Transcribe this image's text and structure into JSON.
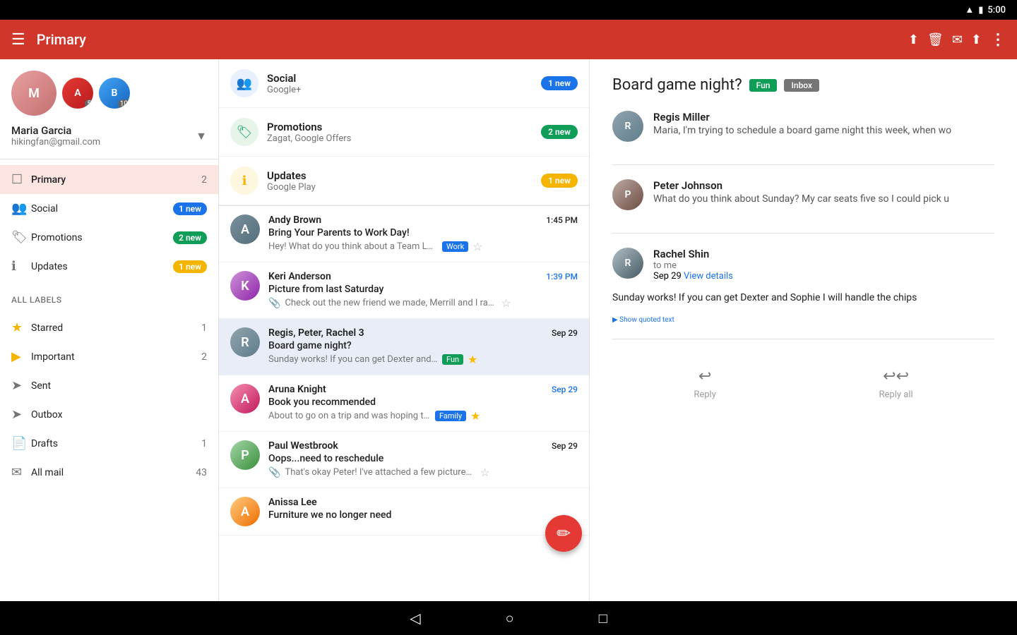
{
  "statusBar": {
    "time": "5:00"
  },
  "toolbar": {
    "title": "Primary",
    "menuIcon": "☰",
    "archiveIcon": "⬆",
    "deleteIcon": "🗑",
    "emailIcon": "✉",
    "labelIcon": "🏷",
    "moreIcon": "⋮"
  },
  "sidebar": {
    "user": {
      "name": "Maria Garcia",
      "email": "hikingfan@gmail.com",
      "avatarInitial": "M",
      "secondaryCount1": "5",
      "secondaryCount2": "10"
    },
    "navItems": [
      {
        "id": "primary",
        "label": "Primary",
        "icon": "☐",
        "count": "2",
        "active": true
      },
      {
        "id": "social",
        "label": "Social",
        "icon": "👥",
        "badge": "1 new",
        "badgeClass": "badge-blue"
      },
      {
        "id": "promotions",
        "label": "Promotions",
        "icon": "🏷",
        "badge": "2 new",
        "badgeClass": "badge-green"
      },
      {
        "id": "updates",
        "label": "Updates",
        "icon": "ℹ",
        "badge": "1 new",
        "badgeClass": "badge-yellow"
      }
    ],
    "allLabelsTitle": "All labels",
    "labelItems": [
      {
        "id": "starred",
        "label": "Starred",
        "icon": "★",
        "count": "1"
      },
      {
        "id": "important",
        "label": "Important",
        "icon": "▶",
        "count": "2"
      },
      {
        "id": "sent",
        "label": "Sent",
        "icon": "➤",
        "count": ""
      },
      {
        "id": "outbox",
        "label": "Outbox",
        "icon": "➤",
        "count": ""
      },
      {
        "id": "drafts",
        "label": "Drafts",
        "icon": "📄",
        "count": "1"
      },
      {
        "id": "allmail",
        "label": "All mail",
        "icon": "✉",
        "count": "43"
      }
    ]
  },
  "emailList": {
    "categories": [
      {
        "id": "social",
        "name": "Social",
        "sub": "Google+",
        "badge": "1 new",
        "badgeClass": "badge-blue",
        "iconClass": "cat-icon-blue",
        "icon": "👥"
      },
      {
        "id": "promotions",
        "name": "Promotions",
        "sub": "Zagat, Google Offers",
        "badge": "2 new",
        "badgeClass": "badge-green",
        "iconClass": "cat-icon-green",
        "icon": "🏷"
      },
      {
        "id": "updates",
        "name": "Updates",
        "sub": "Google Play",
        "badge": "1 new",
        "badgeClass": "badge-yellow",
        "iconClass": "cat-icon-yellow",
        "icon": "ℹ"
      }
    ],
    "emails": [
      {
        "id": "1",
        "sender": "Andy Brown",
        "subject": "Bring Your Parents to Work Day!",
        "preview": "Hey! What do you think about a Team Lunch: Parent...",
        "time": "1:45 PM",
        "timeBlue": false,
        "tag": "Work",
        "tagClass": "tag-work",
        "starred": false,
        "hasAttachment": false,
        "avatarClass": "av-andy",
        "initial": "A",
        "selected": false
      },
      {
        "id": "2",
        "sender": "Keri Anderson",
        "subject": "Picture from last Saturday",
        "preview": "Check out the new friend we made, Merrill and I ran into him...",
        "time": "1:39 PM",
        "timeBlue": true,
        "tag": "",
        "starred": false,
        "hasAttachment": true,
        "avatarClass": "av-keri",
        "initial": "K",
        "selected": false
      },
      {
        "id": "3",
        "sender": "Regis, Peter, Rachel  3",
        "subject": "Board game night?",
        "preview": "Sunday works! If you can get Dexter and Sophie I will...",
        "time": "Sep 29",
        "timeBlue": false,
        "tag": "Fun",
        "tagClass": "tag-fun",
        "starred": true,
        "hasAttachment": false,
        "avatarClass": "av-regis",
        "initial": "R",
        "selected": true
      },
      {
        "id": "4",
        "sender": "Aruna Knight",
        "subject": "Book you recommended",
        "preview": "About to go on a trip and was hoping to start that b...",
        "time": "Sep 29",
        "timeBlue": true,
        "tag": "Family",
        "tagClass": "tag-family",
        "starred": true,
        "hasAttachment": false,
        "avatarClass": "av-aruna",
        "initial": "A",
        "selected": false
      },
      {
        "id": "5",
        "sender": "Paul Westbrook",
        "subject": "Oops...need to reschedule",
        "preview": "That's okay Peter! I've attached a few pictures of my place f...",
        "time": "Sep 29",
        "timeBlue": false,
        "tag": "",
        "starred": false,
        "hasAttachment": true,
        "avatarClass": "av-paul",
        "initial": "P",
        "selected": false
      },
      {
        "id": "6",
        "sender": "Anissa Lee",
        "subject": "Furniture we no longer need",
        "preview": "",
        "time": "",
        "timeBlue": false,
        "tag": "",
        "starred": false,
        "hasAttachment": false,
        "avatarClass": "av-anissa",
        "initial": "A",
        "selected": false
      }
    ]
  },
  "emailDetail": {
    "subject": "Board game night?",
    "tagFun": "Fun",
    "tagInbox": "Inbox",
    "messages": [
      {
        "id": "m1",
        "sender": "Regis Miller",
        "preview": "Maria, I'm trying to schedule a board game night this week, when wo",
        "avatarClass": "av-regis",
        "initial": "R"
      },
      {
        "id": "m2",
        "sender": "Peter Johnson",
        "preview": "What do you think about Sunday? My car seats five so I could pick u",
        "avatarClass": "av-peter",
        "initial": "P"
      },
      {
        "id": "m3",
        "sender": "Rachel Shin",
        "to": "to me",
        "date": "Sep 29",
        "dateLink": "View details",
        "body": "Sunday works! If you can get Dexter and Sophie I will handle the chips",
        "showQuoted": "Show quoted text",
        "avatarClass": "av-rachel",
        "initial": "R"
      }
    ],
    "replyLabel": "Reply",
    "replyAllLabel": "Reply all"
  },
  "bottomNav": {
    "backIcon": "◁",
    "homeIcon": "○",
    "recentIcon": "□"
  }
}
